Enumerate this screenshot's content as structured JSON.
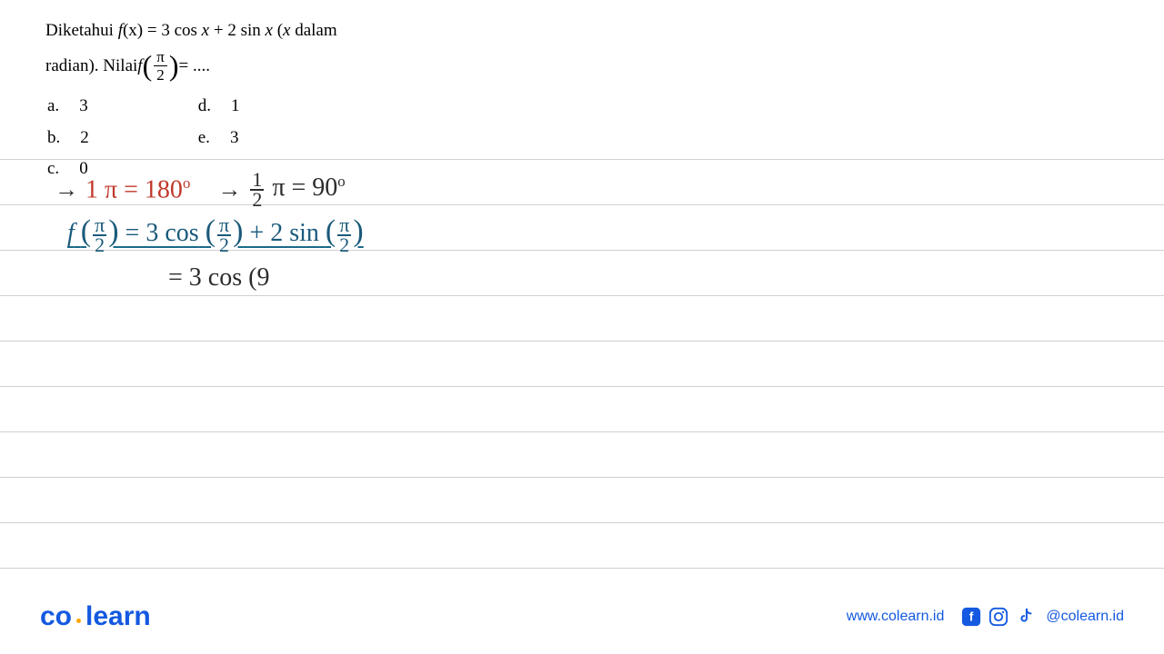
{
  "problem": {
    "line1_pre": "Diketahui ",
    "line1_func": "f",
    "line1_arg": "(x)",
    "line1_eq": " = 3 cos ",
    "line1_x1": "x",
    "line1_plus": " + 2 sin ",
    "line1_x2": "x",
    "line1_post": " (",
    "line1_x3": "x",
    "line1_dalam": " dalam",
    "line2_pre": "radian).  Nilai  ",
    "line2_func": "f",
    "frac_num": "π",
    "frac_den": "2",
    "line2_post": " = ...."
  },
  "options": {
    "a": {
      "letter": "a.",
      "value": "3"
    },
    "b": {
      "letter": "b.",
      "value": "2"
    },
    "c": {
      "letter": "c.",
      "value": "0"
    },
    "d": {
      "letter": "d.",
      "value": "1"
    },
    "e": {
      "letter": "e.",
      "value": "3"
    }
  },
  "handwriting": {
    "line1_arrow": "→",
    "line1_red": "1 π = 180",
    "line1_red_sup": "o",
    "line1_arrow2": "→",
    "line1_black_frac_n": "1",
    "line1_black_frac_d": "2",
    "line1_black_rest": " π = 90",
    "line1_black_sup": "o",
    "line2_f": "f",
    "line2_paren_l": "(",
    "line2_frac1_n": "π",
    "line2_frac1_d": "2",
    "line2_paren_r": ")",
    "line2_eq": "= 3 cos",
    "line2_paren_l2": "(",
    "line2_frac2_n": "π",
    "line2_frac2_d": "2",
    "line2_paren_r2": ")",
    "line2_plus": "+ 2 sin",
    "line2_paren_l3": "(",
    "line2_frac3_n": "π",
    "line2_frac3_d": "2",
    "line2_paren_r3": ")",
    "line3": "= 3 cos (9"
  },
  "footer": {
    "logo_co": "co",
    "logo_learn": "learn",
    "website": "www.colearn.id",
    "handle": "@colearn.id"
  }
}
